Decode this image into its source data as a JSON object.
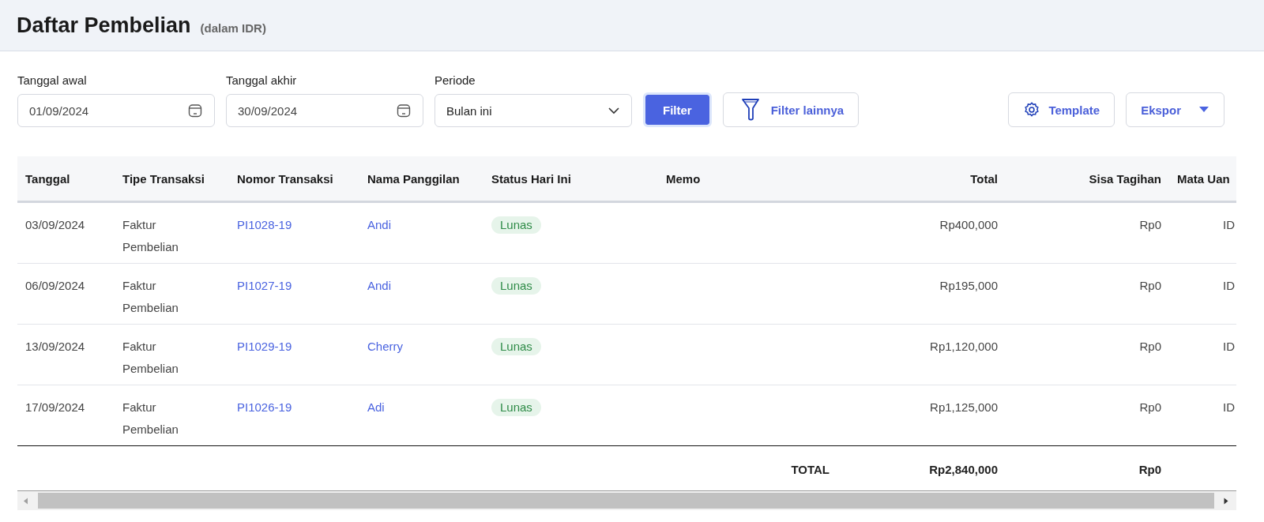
{
  "header": {
    "title": "Daftar Pembelian",
    "subtitle": "(dalam IDR)"
  },
  "filters": [
    {
      "kind": "date",
      "label": "Tanggal awal",
      "value": "01/09/2024"
    },
    {
      "kind": "date",
      "label": "Tanggal akhir",
      "value": "30/09/2024"
    },
    {
      "kind": "select",
      "label": "Periode",
      "value": "Bulan ini"
    }
  ],
  "actions": [
    {
      "kind": "primary",
      "label": "Filter"
    },
    {
      "kind": "more-filter",
      "label": "Filter lainnya"
    }
  ],
  "right_actions": [
    {
      "kind": "template",
      "label": "Template"
    },
    {
      "kind": "export",
      "label": "Ekspor"
    }
  ],
  "table": {
    "columns": [
      {
        "label": "Tanggal",
        "kind": "text"
      },
      {
        "label": "Tipe Transaksi",
        "kind": "text"
      },
      {
        "label": "Nomor Transaksi",
        "kind": "link"
      },
      {
        "label": "Nama Panggilan",
        "kind": "link"
      },
      {
        "label": "Status Hari Ini",
        "kind": "status"
      },
      {
        "label": "Memo",
        "kind": "text"
      },
      {
        "label": "Total",
        "kind": "amount"
      },
      {
        "label": "Sisa Tagihan",
        "kind": "amount"
      },
      {
        "label": "Mata Uan",
        "kind": "currency"
      }
    ],
    "rows": [
      [
        "03/09/2024",
        "Faktur Pembelian",
        "PI1028-19",
        "Andi",
        "Lunas",
        "",
        "Rp400,000",
        "Rp0",
        "ID"
      ],
      [
        "06/09/2024",
        "Faktur Pembelian",
        "PI1027-19",
        "Andi",
        "Lunas",
        "",
        "Rp195,000",
        "Rp0",
        "ID"
      ],
      [
        "13/09/2024",
        "Faktur Pembelian",
        "PI1029-19",
        "Cherry",
        "Lunas",
        "",
        "Rp1,120,000",
        "Rp0",
        "ID"
      ],
      [
        "17/09/2024",
        "Faktur Pembelian",
        "PI1026-19",
        "Adi",
        "Lunas",
        "",
        "Rp1,125,000",
        "Rp0",
        "ID"
      ]
    ],
    "footer": {
      "label": "TOTAL",
      "total": "Rp2,840,000",
      "remaining": "Rp0"
    }
  }
}
